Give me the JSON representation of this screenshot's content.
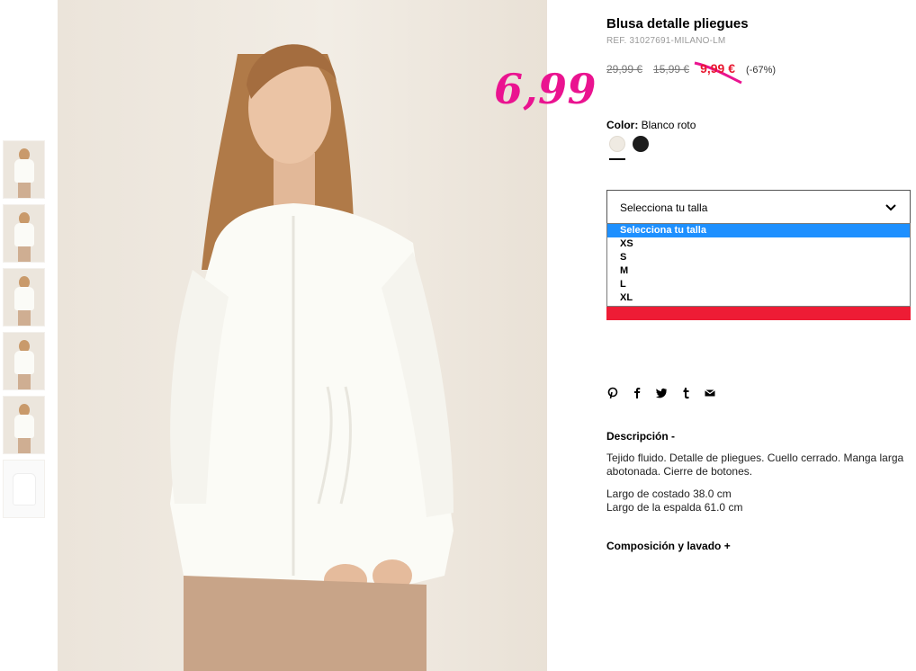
{
  "product": {
    "title": "Blusa detalle pliegues",
    "ref": "REF. 31027691-MILANO-LM",
    "prices": {
      "original": "29,99 €",
      "previous": "15,99 €",
      "sale": "9,99 €",
      "discount": "(-67%)"
    },
    "overlay_price": "6,99",
    "color": {
      "label": "Color:",
      "value": "Blanco roto",
      "swatches": [
        {
          "name": "Blanco roto",
          "hex": "#efeae2"
        },
        {
          "name": "Negro",
          "hex": "#1c1c1c"
        }
      ]
    },
    "size_select": {
      "value": "Selecciona tu talla",
      "options": [
        "Selecciona tu talla",
        "XS",
        "S",
        "M",
        "L",
        "XL"
      ],
      "highlighted": "Selecciona tu talla"
    },
    "share_icons": [
      "pinterest-icon",
      "facebook-icon",
      "twitter-icon",
      "tumblr-icon",
      "mail-icon"
    ],
    "description": {
      "title": "Descripción -",
      "text": "Tejido fluido. Detalle de pliegues. Cuello cerrado. Manga larga abotonada. Cierre de botones.",
      "measures": [
        "Largo de costado 38.0 cm",
        "Largo de la espalda 61.0 cm"
      ]
    },
    "composition_title": "Composición y lavado +"
  },
  "colors": {
    "sale_red": "#e8172f",
    "button_red": "#ee1c35",
    "overlay_pink": "#ea1390",
    "select_highlight": "#1e90ff"
  }
}
